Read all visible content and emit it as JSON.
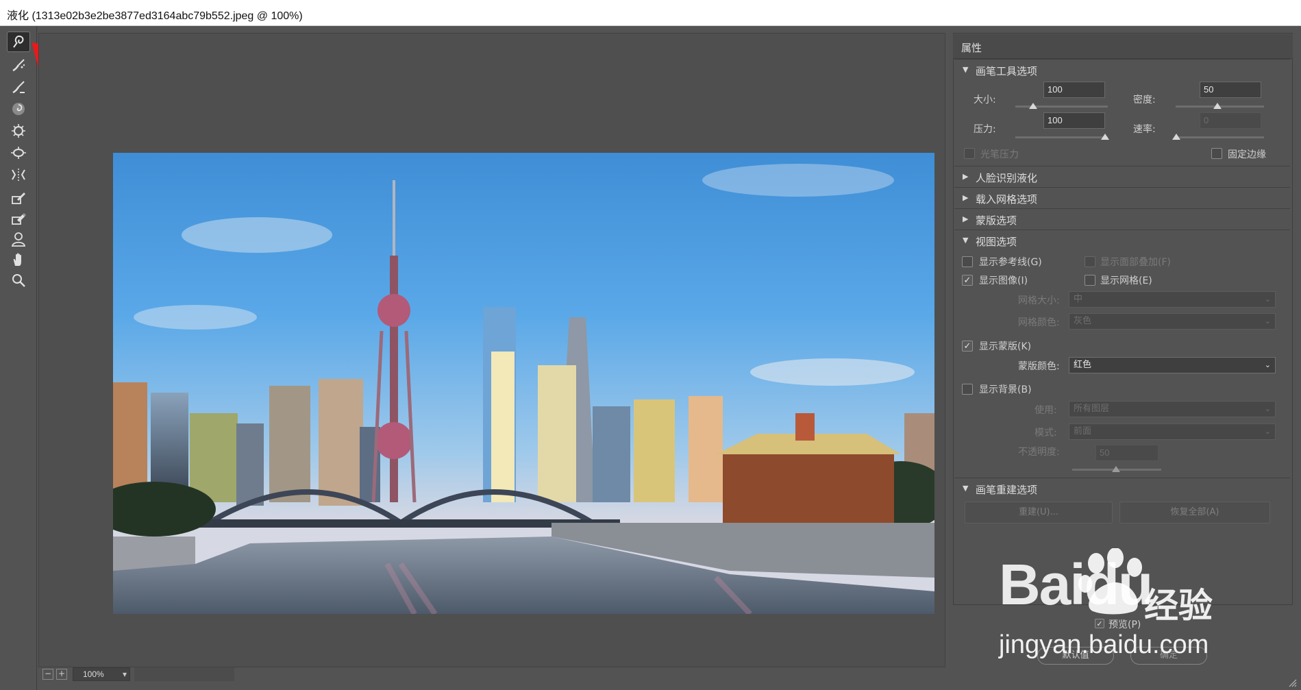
{
  "window": {
    "title": "液化 (1313e02b3e2be3877ed3164abc79b552.jpeg @ 100%)"
  },
  "tools": [
    {
      "name": "forward-warp-tool-icon",
      "active": true
    },
    {
      "name": "reconstruct-tool-icon",
      "active": false
    },
    {
      "name": "smooth-tool-icon",
      "active": false
    },
    {
      "name": "twirl-clockwise-tool-icon",
      "active": false
    },
    {
      "name": "pucker-tool-icon",
      "active": false
    },
    {
      "name": "bloat-tool-icon",
      "active": false
    },
    {
      "name": "push-left-tool-icon",
      "active": false
    },
    {
      "name": "freeze-mask-tool-icon",
      "active": false
    },
    {
      "name": "thaw-mask-tool-icon",
      "active": false
    },
    {
      "name": "face-tool-icon",
      "active": false
    },
    {
      "name": "hand-tool-icon",
      "active": false
    },
    {
      "name": "zoom-tool-icon",
      "active": false
    }
  ],
  "status": {
    "zoom": "100%",
    "zoom_out": "−",
    "zoom_in": "+"
  },
  "panel": {
    "title": "属性",
    "brush_section": "画笔工具选项",
    "size_label": "大小:",
    "size_value": "100",
    "density_label": "密度:",
    "density_value": "50",
    "pressure_label": "压力:",
    "pressure_value": "100",
    "rate_label": "速率:",
    "rate_value": "0",
    "stylus_label": "光笔压力",
    "pin_edges_label": "固定边缘",
    "face_section": "人脸识别液化",
    "load_mesh_section": "载入网格选项",
    "mask_section": "蒙版选项",
    "view_section": "视图选项",
    "show_guides": "显示参考线(G)",
    "show_face_overlay": "显示面部叠加(F)",
    "show_image": "显示图像(I)",
    "show_mesh": "显示网格(E)",
    "mesh_size_label": "网格大小:",
    "mesh_size_value": "中",
    "mesh_color_label": "网格颜色:",
    "mesh_color_value": "灰色",
    "show_mask": "显示蒙版(K)",
    "mask_color_label": "蒙版颜色:",
    "mask_color_value": "红色",
    "show_backdrop": "显示背景(B)",
    "use_label": "使用:",
    "use_value": "所有图层",
    "mode_label": "模式:",
    "mode_value": "前面",
    "opacity_label": "不透明度:",
    "opacity_value": "50",
    "reconstruct_section": "画笔重建选项",
    "reconstruct_button": "重建(U)...",
    "restore_all_button": "恢复全部(A)",
    "preview_label": "预览(P)",
    "default_button": "默认值",
    "ok_button": "确定"
  },
  "watermark": {
    "brand": "Baidu",
    "brand_cn": "经验",
    "url": "jingyan.baidu.com"
  },
  "colors": {
    "accent_arrow": "#e8191b",
    "panel_bg": "#535353"
  }
}
